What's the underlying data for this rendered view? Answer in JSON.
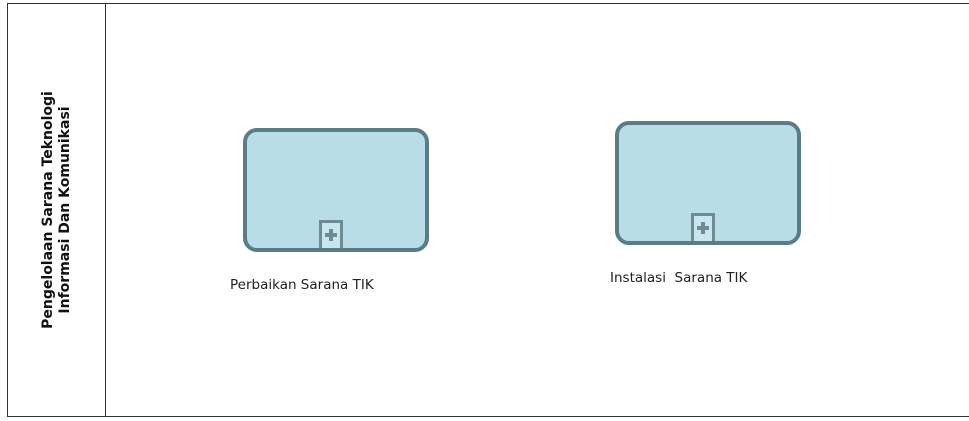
{
  "diagram": {
    "lane": {
      "title_line1": "Pengelolaan Sarana Teknologi",
      "title_line2": "Informasi Dan Komunikasi"
    },
    "tasks": [
      {
        "label": "Perbaikan Sarana TIK",
        "marker": "plus-icon"
      },
      {
        "label": "Instalasi  Sarana TIK",
        "marker": "plus-icon"
      }
    ],
    "colors": {
      "task_fill": "#b8dde6",
      "task_border": "#5a7c86",
      "lane_border": "#333333"
    }
  }
}
